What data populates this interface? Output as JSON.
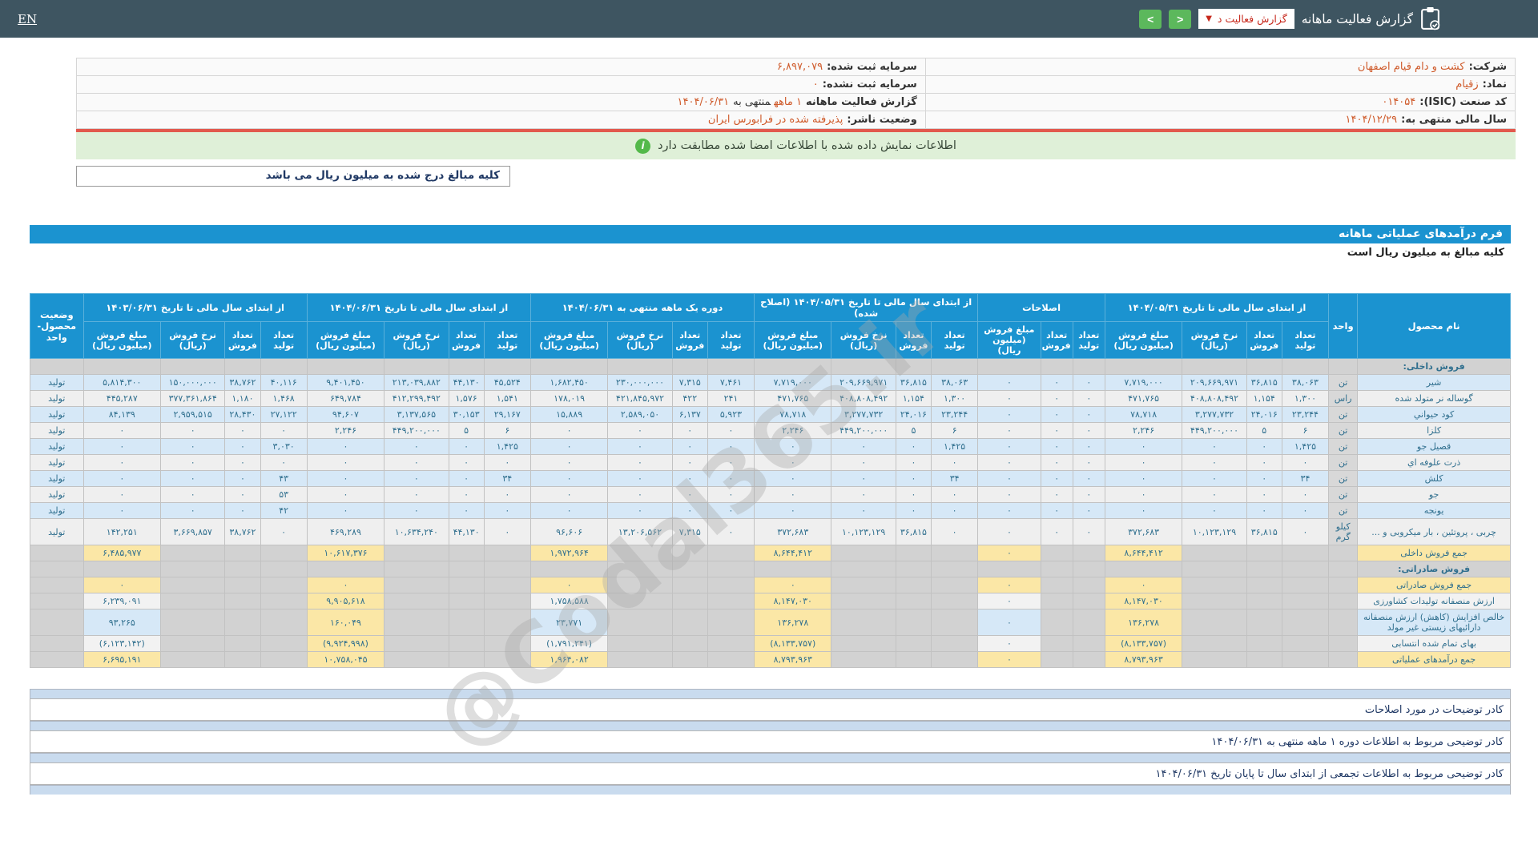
{
  "topbar": {
    "title": "گزارش فعالیت ماهانه",
    "dropdown_label": "گزارش فعالیت د",
    "lang": "EN",
    "nav_prev": "<",
    "nav_next": ">"
  },
  "info": {
    "rows": [
      {
        "right": {
          "label": "شرکت:",
          "value": "کشت و دام قیام اصفهان"
        },
        "left": {
          "label": "سرمایه ثبت شده:",
          "value": "۶,۸۹۷,۰۷۹"
        }
      },
      {
        "right": {
          "label": "نماد:",
          "value": "زقیام"
        },
        "left": {
          "label": "سرمایه ثبت نشده:",
          "value": "۰"
        }
      },
      {
        "right": {
          "label": "کد صنعت (ISIC):",
          "value": "۰۱۴۰۵۴"
        },
        "left": {
          "label": "گزارش فعالیت ماهانه",
          "segments": [
            {
              "text": "۱ ماهه",
              "accent": true
            },
            {
              "text": "منتهی به",
              "accent": false
            },
            {
              "text": "۱۴۰۴/۰۶/۳۱",
              "accent": true
            }
          ]
        }
      },
      {
        "right": {
          "label": "سال مالی منتهی به:",
          "value": "۱۴۰۴/۱۲/۲۹"
        },
        "left": {
          "label": "وضعیت ناشر:",
          "value": "پذیرفته شده در فرابورس ایران"
        }
      }
    ]
  },
  "notice": {
    "text": "اطلاعات نمایش داده شده با اطلاعات امضا شده مطابقت دارد",
    "icon": "info-icon"
  },
  "unit_note": "کلیه مبالغ درج شده به میلیون ریال می باشد",
  "form": {
    "title": "فرم درآمدهای عملیاتی ماهانه",
    "subtitle": "کلیه مبالغ به میلیون ریال است"
  },
  "watermark": "@Codal365.ir",
  "colors": {
    "topbar": "#3e5561",
    "header_blue": "#1b93d0",
    "row_blue": "#d6e8f7",
    "row_gray": "#efefef",
    "highlight_yellow": "#fbe7a6",
    "disabled_gray": "#d2d2d2",
    "negative_red": "#e02a1f",
    "accent_orange": "#cf5a2a",
    "success_green": "#dff0d8",
    "button_green": "#5cb85c",
    "divider_red": "#e2594d"
  },
  "table": {
    "first_col": "نام محصول",
    "unit_col": "واحد",
    "status_col": "وضعیت\nمحصول-واحد",
    "col_groups": [
      {
        "key": "g1",
        "label": "از ابتدای سال مالی تا تاریخ ۱۴۰۴/۰۵/۳۱",
        "cols": 4
      },
      {
        "key": "adj",
        "label": "اصلاحات",
        "cols": 3
      },
      {
        "key": "g3",
        "label": "از ابتدای سال مالی تا تاریخ ۱۴۰۴/۰۵/۳۱ (اصلاح شده)",
        "cols": 4
      },
      {
        "key": "g4",
        "label": "دوره یک ماهه منتهی به ۱۴۰۴/۰۶/۳۱",
        "cols": 4
      },
      {
        "key": "g5",
        "label": "از ابتدای سال مالی تا تاریخ ۱۴۰۴/۰۶/۳۱",
        "cols": 4
      },
      {
        "key": "g6",
        "label": "از ابتدای سال مالی تا تاریخ ۱۴۰۳/۰۶/۳۱",
        "cols": 4
      }
    ],
    "sub_headers": {
      "qty_prod": "تعداد\nتولید",
      "qty_sale": "تعداد\nفروش",
      "rate": "نرخ فروش\n(ریال)",
      "amount": "مبلغ فروش\n(میلیون ریال)"
    },
    "rows": [
      {
        "type": "section",
        "label": "فروش داخلی:"
      },
      {
        "type": "product",
        "name": "شیر",
        "unit": "تن",
        "status": "تولید",
        "tint": "blue",
        "g1": [
          "۳۸,۰۶۳",
          "۳۶,۸۱۵",
          "۲۰۹,۶۶۹,۹۷۱",
          "۷,۷۱۹,۰۰۰"
        ],
        "adj": [
          "۰",
          "۰",
          "۰"
        ],
        "g3": [
          "۳۸,۰۶۳",
          "۳۶,۸۱۵",
          "۲۰۹,۶۶۹,۹۷۱",
          "۷,۷۱۹,۰۰۰"
        ],
        "g4": [
          "۷,۴۶۱",
          "۷,۳۱۵",
          "۲۳۰,۰۰۰,۰۰۰",
          "۱,۶۸۲,۴۵۰"
        ],
        "g5": [
          "۴۵,۵۲۴",
          "۴۴,۱۳۰",
          "۲۱۳,۰۳۹,۸۸۲",
          "۹,۴۰۱,۴۵۰"
        ],
        "g6": [
          "۴۰,۱۱۶",
          "۳۸,۷۶۲",
          "۱۵۰,۰۰۰,۰۰۰",
          "۵,۸۱۴,۳۰۰"
        ]
      },
      {
        "type": "product",
        "name": "گوساله نر متولد شده",
        "unit": "راس",
        "status": "تولید",
        "tint": "gray",
        "g1": [
          "۱,۳۰۰",
          "۱,۱۵۴",
          "۴۰۸,۸۰۸,۴۹۲",
          "۴۷۱,۷۶۵"
        ],
        "adj": [
          "۰",
          "۰",
          "۰"
        ],
        "g3": [
          "۱,۳۰۰",
          "۱,۱۵۴",
          "۴۰۸,۸۰۸,۴۹۲",
          "۴۷۱,۷۶۵"
        ],
        "g4": [
          "۲۴۱",
          "۴۲۲",
          "۴۲۱,۸۴۵,۹۷۲",
          "۱۷۸,۰۱۹"
        ],
        "g5": [
          "۱,۵۴۱",
          "۱,۵۷۶",
          "۴۱۲,۲۹۹,۴۹۲",
          "۶۴۹,۷۸۴"
        ],
        "g6": [
          "۱,۴۶۸",
          "۱,۱۸۰",
          "۳۷۷,۳۶۱,۸۶۴",
          "۴۴۵,۲۸۷"
        ]
      },
      {
        "type": "product",
        "name": "کود حیواني",
        "unit": "تن",
        "status": "تولید",
        "tint": "blue",
        "g1": [
          "۲۳,۲۴۴",
          "۲۴,۰۱۶",
          "۳,۲۷۷,۷۳۲",
          "۷۸,۷۱۸"
        ],
        "adj": [
          "۰",
          "۰",
          "۰"
        ],
        "g3": [
          "۲۳,۲۴۴",
          "۲۴,۰۱۶",
          "۳,۲۷۷,۷۳۲",
          "۷۸,۷۱۸"
        ],
        "g4": [
          "۵,۹۲۳",
          "۶,۱۳۷",
          "۲,۵۸۹,۰۵۰",
          "۱۵,۸۸۹"
        ],
        "g5": [
          "۲۹,۱۶۷",
          "۳۰,۱۵۳",
          "۳,۱۳۷,۵۶۵",
          "۹۴,۶۰۷"
        ],
        "g6": [
          "۲۷,۱۲۲",
          "۲۸,۴۳۰",
          "۲,۹۵۹,۵۱۵",
          "۸۴,۱۳۹"
        ]
      },
      {
        "type": "product",
        "name": "کلزا",
        "unit": "تن",
        "status": "تولید",
        "tint": "gray",
        "g1": [
          "۶",
          "۵",
          "۴۴۹,۲۰۰,۰۰۰",
          "۲,۲۴۶"
        ],
        "adj": [
          "۰",
          "۰",
          "۰"
        ],
        "g3": [
          "۶",
          "۵",
          "۴۴۹,۲۰۰,۰۰۰",
          "۲,۲۴۶"
        ],
        "g4": [
          "۰",
          "۰",
          "۰",
          "۰"
        ],
        "g5": [
          "۶",
          "۵",
          "۴۴۹,۲۰۰,۰۰۰",
          "۲,۲۴۶"
        ],
        "g6": [
          "۰",
          "۰",
          "۰",
          "۰"
        ]
      },
      {
        "type": "product",
        "name": "قصیل جو",
        "unit": "تن",
        "status": "تولید",
        "tint": "blue",
        "g1": [
          "۱,۴۲۵",
          "۰",
          "۰",
          "۰"
        ],
        "adj": [
          "۰",
          "۰",
          "۰"
        ],
        "g3": [
          "۱,۴۲۵",
          "۰",
          "۰",
          "۰"
        ],
        "g4": [
          "۰",
          "۰",
          "۰",
          "۰"
        ],
        "g5": [
          "۱,۴۲۵",
          "۰",
          "۰",
          "۰"
        ],
        "g6": [
          "۳,۰۳۰",
          "۰",
          "۰",
          "۰"
        ]
      },
      {
        "type": "product",
        "name": "ذرت علوفه اي",
        "unit": "تن",
        "status": "تولید",
        "tint": "gray",
        "g1": [
          "۰",
          "۰",
          "۰",
          "۰"
        ],
        "adj": [
          "۰",
          "۰",
          "۰"
        ],
        "g3": [
          "۰",
          "۰",
          "۰",
          "۰"
        ],
        "g4": [
          "۰",
          "۰",
          "۰",
          "۰"
        ],
        "g5": [
          "۰",
          "۰",
          "۰",
          "۰"
        ],
        "g6": [
          "۰",
          "۰",
          "۰",
          "۰"
        ]
      },
      {
        "type": "product",
        "name": "کلش",
        "unit": "تن",
        "status": "تولید",
        "tint": "blue",
        "g1": [
          "۳۴",
          "۰",
          "۰",
          "۰"
        ],
        "adj": [
          "۰",
          "۰",
          "۰"
        ],
        "g3": [
          "۳۴",
          "۰",
          "۰",
          "۰"
        ],
        "g4": [
          "۰",
          "۰",
          "۰",
          "۰"
        ],
        "g5": [
          "۳۴",
          "۰",
          "۰",
          "۰"
        ],
        "g6": [
          "۴۳",
          "۰",
          "۰",
          "۰"
        ]
      },
      {
        "type": "product",
        "name": "جو",
        "unit": "تن",
        "status": "تولید",
        "tint": "gray",
        "g1": [
          "۰",
          "۰",
          "۰",
          "۰"
        ],
        "adj": [
          "۰",
          "۰",
          "۰"
        ],
        "g3": [
          "۰",
          "۰",
          "۰",
          "۰"
        ],
        "g4": [
          "۰",
          "۰",
          "۰",
          "۰"
        ],
        "g5": [
          "۰",
          "۰",
          "۰",
          "۰"
        ],
        "g6": [
          "۵۳",
          "۰",
          "۰",
          "۰"
        ]
      },
      {
        "type": "product",
        "name": "یونجه",
        "unit": "تن",
        "status": "تولید",
        "tint": "blue",
        "g1": [
          "۰",
          "۰",
          "۰",
          "۰"
        ],
        "adj": [
          "۰",
          "۰",
          "۰"
        ],
        "g3": [
          "۰",
          "۰",
          "۰",
          "۰"
        ],
        "g4": [
          "۰",
          "۰",
          "۰",
          "۰"
        ],
        "g5": [
          "۰",
          "۰",
          "۰",
          "۰"
        ],
        "g6": [
          "۴۲",
          "۰",
          "۰",
          "۰"
        ]
      },
      {
        "type": "product",
        "name": "چربی ، پروتئین ، بار میکروبی و ...",
        "unit": "کیلو گرم",
        "status": "تولید",
        "tint": "gray",
        "g1": [
          "۰",
          "۳۶,۸۱۵",
          "۱۰,۱۲۳,۱۲۹",
          "۳۷۲,۶۸۳"
        ],
        "adj": [
          "۰",
          "۰",
          "۰"
        ],
        "g3": [
          "۰",
          "۳۶,۸۱۵",
          "۱۰,۱۲۳,۱۲۹",
          "۳۷۲,۶۸۳"
        ],
        "g4": [
          "۰",
          "۷,۳۱۵",
          "۱۳,۲۰۶,۵۶۲",
          "۹۶,۶۰۶"
        ],
        "g5": [
          "۰",
          "۴۴,۱۳۰",
          "۱۰,۶۳۴,۲۴۰",
          "۴۶۹,۲۸۹"
        ],
        "g6": [
          "۰",
          "۳۸,۷۶۲",
          "۳,۶۶۹,۸۵۷",
          "۱۴۲,۲۵۱"
        ]
      },
      {
        "type": "summary",
        "label": "جمع فروش داخلی",
        "style": "total",
        "amounts": {
          "g1": "۸,۶۴۴,۴۱۲",
          "adj": "۰",
          "g3": "۸,۶۴۴,۴۱۲",
          "g4": "۱,۹۷۲,۹۶۴",
          "g5": "۱۰,۶۱۷,۳۷۶",
          "g6": "۶,۴۸۵,۹۷۷"
        }
      },
      {
        "type": "section",
        "label": "فروش صادراتی:"
      },
      {
        "type": "summary",
        "label": "جمع فروش صادراتی",
        "style": "total",
        "amounts": {
          "g1": "۰",
          "adj": "۰",
          "g3": "۰",
          "g4": "۰",
          "g5": "۰",
          "g6": "۰"
        }
      },
      {
        "type": "summary",
        "label": "ارزش منصفانه تولیدات کشاورزی",
        "style": "calc",
        "tint": "#f2f2f2",
        "amounts": {
          "g1": "۸,۱۴۷,۰۳۰",
          "adj": "۰",
          "g3": "۸,۱۴۷,۰۳۰",
          "g4": "۱,۷۵۸,۵۸۸",
          "g5": "۹,۹۰۵,۶۱۸",
          "g6": "۶,۲۳۹,۰۹۱"
        }
      },
      {
        "type": "summary",
        "label": "خالص افزایش (کاهش) ارزش منصفانه دارائیهای زیستی غیر مولد",
        "style": "calc",
        "tint": "#d6e8f7",
        "amounts": {
          "g1": "۱۳۶,۲۷۸",
          "adj": "۰",
          "g3": "۱۳۶,۲۷۸",
          "g4": "۲۳,۷۷۱",
          "g5": "۱۶۰,۰۴۹",
          "g6": "۹۳,۲۶۵"
        }
      },
      {
        "type": "summary",
        "label": "بهای تمام شده انتسابی",
        "style": "calc",
        "tint": "#f2f2f2",
        "negative": true,
        "amounts": {
          "g1": "(۸,۱۳۳,۷۵۷)",
          "adj": "۰",
          "g3": "(۸,۱۳۳,۷۵۷)",
          "g4": "(۱,۷۹۱,۲۴۱)",
          "g5": "(۹,۹۲۴,۹۹۸)",
          "g6": "(۶,۱۲۳,۱۴۲)"
        }
      },
      {
        "type": "summary",
        "label": "جمع درآمدهای عملیاتی",
        "style": "total",
        "amounts": {
          "g1": "۸,۷۹۳,۹۶۳",
          "adj": "۰",
          "g3": "۸,۷۹۳,۹۶۳",
          "g4": "۱,۹۶۴,۰۸۲",
          "g5": "۱۰,۷۵۸,۰۴۵",
          "g6": "۶,۶۹۵,۱۹۱"
        }
      }
    ]
  },
  "footers": [
    "کادر توضیحات در مورد اصلاحات",
    "کادر توضیحی مربوط به اطلاعات دوره ۱ ماهه منتهی به ۱۴۰۴/۰۶/۳۱",
    "کادر توضیحی مربوط به اطلاعات تجمعی از ابتدای سال تا پایان تاریخ ۱۴۰۴/۰۶/۳۱"
  ]
}
